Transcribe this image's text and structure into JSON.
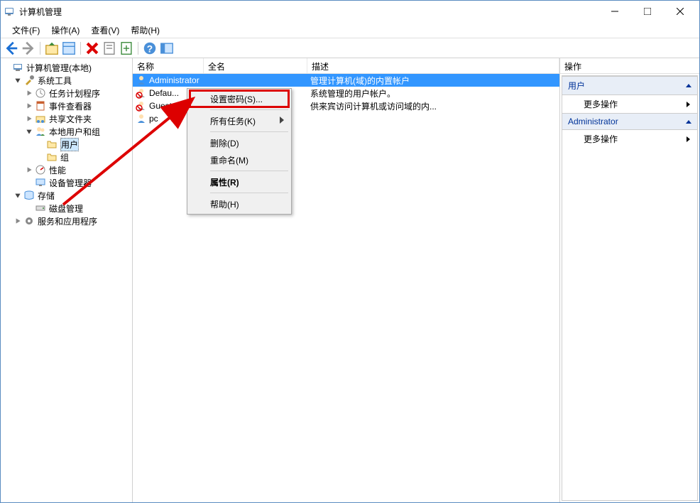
{
  "title": "计算机管理",
  "menu": {
    "file": "文件(F)",
    "action": "操作(A)",
    "view": "查看(V)",
    "help": "帮助(H)"
  },
  "tree": {
    "root": "计算机管理(本地)",
    "system_tools": "系统工具",
    "task_scheduler": "任务计划程序",
    "event_viewer": "事件查看器",
    "shared_folders": "共享文件夹",
    "local_users": "本地用户和组",
    "users": "用户",
    "groups": "组",
    "performance": "性能",
    "device_mgr": "设备管理器",
    "storage": "存储",
    "disk_mgmt": "磁盘管理",
    "services_apps": "服务和应用程序"
  },
  "list": {
    "col_name": "名称",
    "col_full": "全名",
    "col_desc": "描述",
    "rows": [
      {
        "name": "Administrator",
        "full": "",
        "desc": "管理计算机(域)的内置帐户",
        "selected": true,
        "disabled": false
      },
      {
        "name": "Defau...",
        "full": "",
        "desc": "系统管理的用户帐户。",
        "selected": false,
        "disabled": true
      },
      {
        "name": "Guest",
        "full": "",
        "desc": "供来宾访问计算机或访问域的内...",
        "selected": false,
        "disabled": true
      },
      {
        "name": "pc",
        "full": "",
        "desc": "",
        "selected": false,
        "disabled": false
      }
    ]
  },
  "ctx": {
    "set_pwd": "设置密码(S)...",
    "all_tasks": "所有任务(K)",
    "delete": "删除(D)",
    "rename": "重命名(M)",
    "properties": "属性(R)",
    "help": "帮助(H)"
  },
  "actions": {
    "header": "操作",
    "section_users": "用户",
    "more": "更多操作",
    "section_admin": "Administrator"
  }
}
